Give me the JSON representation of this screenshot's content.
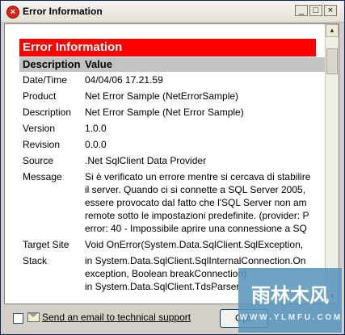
{
  "window": {
    "title": "Error Information",
    "buttons": {
      "minimize": "_",
      "maximize": "□",
      "close": "×"
    }
  },
  "report": {
    "heading": "Error Information",
    "columns": {
      "description": "Description",
      "value": "Value"
    },
    "rows": [
      {
        "label": "Date/Time",
        "lines": [
          "04/04/06 17.21.59"
        ]
      },
      {
        "label": "Product",
        "lines": [
          "Net Error Sample (NetErrorSample)"
        ]
      },
      {
        "label": "Description",
        "lines": [
          "Net Error Sample (Net Error Sample)"
        ]
      },
      {
        "label": "Version",
        "lines": [
          "1.0.0"
        ]
      },
      {
        "label": "Revision",
        "lines": [
          "0.0.0"
        ]
      },
      {
        "label": "Source",
        "lines": [
          ".Net SqlClient Data Provider"
        ]
      },
      {
        "label": "Message",
        "lines": [
          "Si è verificato un errore mentre si cercava di stabilire",
          "il server. Quando ci si connette a SQL Server 2005,",
          "essere provocato dal fatto che l'SQL Server non am",
          "remote sotto le impostazioni predefinite. (provider: P",
          "error: 40 - Impossibile aprire una connessione a SQ"
        ]
      },
      {
        "label": "Target Site",
        "lines": [
          "Void OnError(System.Data.SqlClient.SqlException,"
        ]
      },
      {
        "label": "Stack",
        "lines": [
          "in System.Data.SqlClient.SqlInternalConnection.On",
          "exception, Boolean breakConnection)",
          "in System.Data.SqlClient.TdsParser"
        ]
      }
    ]
  },
  "footer": {
    "send_email_label": "Send an email to technical support",
    "send_email_checked": false,
    "options_button": "Opti"
  },
  "watermark": {
    "text": "雨林木风",
    "url": "W W W . Y L M F U . C O M"
  },
  "colors": {
    "heading_bg": "#ff0000",
    "header_row_bg": "#c3c3c3",
    "title_bar": "#ece9d8"
  }
}
